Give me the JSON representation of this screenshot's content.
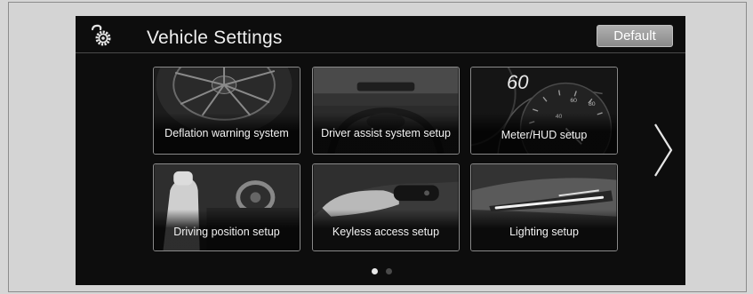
{
  "header": {
    "title": "Vehicle Settings",
    "default_label": "Default",
    "icon": "settings-gear-icon"
  },
  "tiles": [
    {
      "label": "Deflation warning system",
      "icon": "tire-wheel-image"
    },
    {
      "label": "Driver assist system setup",
      "icon": "steering-windshield-image"
    },
    {
      "label": "Meter/HUD setup",
      "icon": "speedometer-image",
      "gauge_value": "60"
    },
    {
      "label": "Driving position setup",
      "icon": "seat-steering-image"
    },
    {
      "label": "Keyless access setup",
      "icon": "key-fob-image"
    },
    {
      "label": "Lighting setup",
      "icon": "headlight-image"
    }
  ],
  "navigation": {
    "next_icon": "chevron-right-icon",
    "page_current": 1,
    "page_total": 2
  },
  "colors": {
    "screen_bg": "#0d0d0d",
    "text": "#efefef",
    "button_bg": "#9c9c9c",
    "tile_border": "#8a8a8a"
  }
}
